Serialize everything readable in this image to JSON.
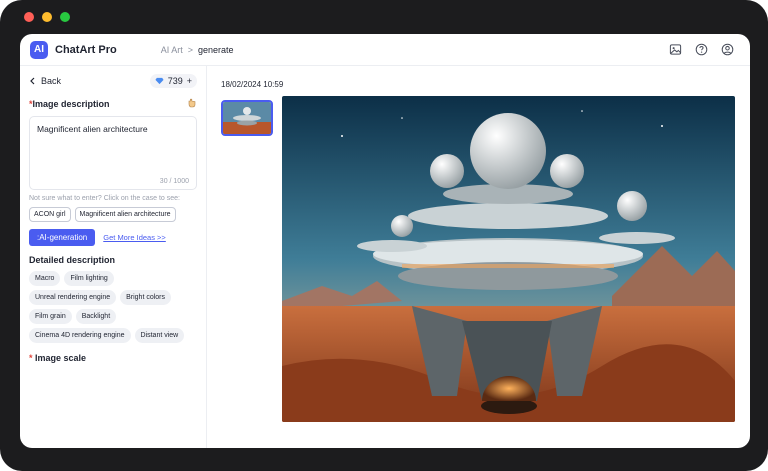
{
  "app": {
    "logo_text": "AI",
    "name": "ChatArt Pro"
  },
  "breadcrumb": {
    "parent": "AI Art",
    "separator": ">",
    "current": "generate"
  },
  "top_icons": [
    "image-icon",
    "help-icon",
    "user-icon"
  ],
  "sidebar": {
    "back_label": "Back",
    "credits": "739",
    "credits_plus": "+",
    "description_title": "Image description",
    "required_mark": "*",
    "description_value": "Magnificent alien architecture",
    "char_count": "30 / 1000",
    "hint": "Not sure what to enter? Click on the case to see:",
    "cases": [
      "ACON girl",
      "Magnificent alien architecture"
    ],
    "ai_button": ":AI-generation",
    "more_ideas": "Get More Ideas >>",
    "detail_title": "Detailed description",
    "tags": [
      "Macro",
      "Film lighting",
      "Unreal rendering engine",
      "Bright colors",
      "Film grain",
      "Backlight",
      "Cinema 4D rendering engine",
      "Distant view"
    ],
    "scale_title": "Image scale"
  },
  "main": {
    "timestamp": "18/02/2024 10:59"
  },
  "colors": {
    "accent": "#4a5cf0",
    "required": "#e0463d"
  }
}
